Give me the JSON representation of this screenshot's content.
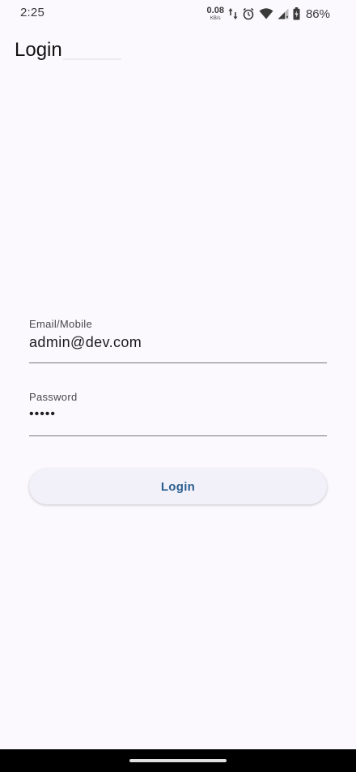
{
  "status_bar": {
    "time": "2:25",
    "net_speed_value": "0.08",
    "net_speed_unit": "KB/s",
    "battery_percent": "86%",
    "icons": [
      "data-transfer-icon",
      "alarm-icon",
      "wifi-icon",
      "cell-signal-icon",
      "battery-icon"
    ]
  },
  "app_bar": {
    "title": "Login"
  },
  "form": {
    "email": {
      "label": "Email/Mobile",
      "value": "admin@dev.com"
    },
    "password": {
      "label": "Password",
      "value": "•••••"
    },
    "submit_label": "Login"
  },
  "colors": {
    "background": "#fbf9fd",
    "button_text": "#2c5f8f",
    "button_bg": "#f2f1f9",
    "underline": "#79747e"
  }
}
